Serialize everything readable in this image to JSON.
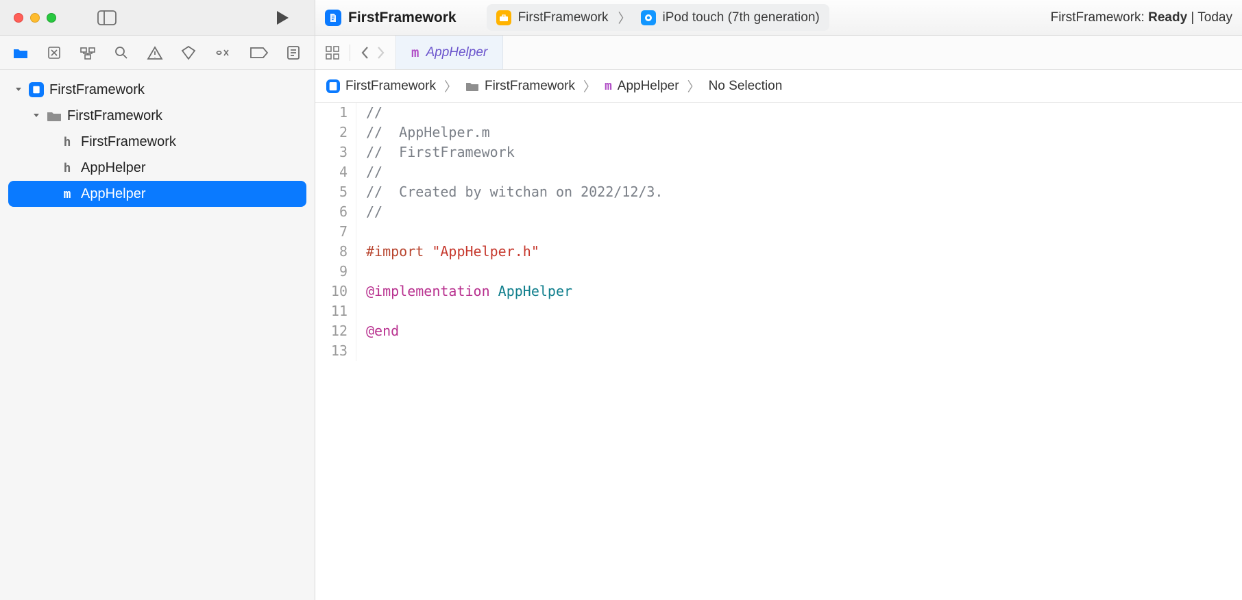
{
  "titlebar": {
    "project": "FirstFramework",
    "scheme": {
      "target": "FirstFramework",
      "device": "iPod touch (7th generation)"
    },
    "status": {
      "project": "FirstFramework",
      "state": "Ready",
      "time": "Today"
    }
  },
  "tree": {
    "root": "FirstFramework",
    "group": "FirstFramework",
    "files": [
      {
        "name": "FirstFramework",
        "icon": "h"
      },
      {
        "name": "AppHelper",
        "icon": "h"
      },
      {
        "name": "AppHelper",
        "icon": "m",
        "selected": true
      }
    ]
  },
  "tab": {
    "name": "AppHelper",
    "badge": "m"
  },
  "jumpbar": {
    "crumbs": [
      "FirstFramework",
      "FirstFramework",
      "AppHelper",
      "No Selection"
    ]
  },
  "code": {
    "lines": [
      {
        "n": 1,
        "tokens": [
          {
            "t": "//",
            "c": "comment"
          }
        ]
      },
      {
        "n": 2,
        "tokens": [
          {
            "t": "//  AppHelper.m",
            "c": "comment"
          }
        ]
      },
      {
        "n": 3,
        "tokens": [
          {
            "t": "//  FirstFramework",
            "c": "comment"
          }
        ]
      },
      {
        "n": 4,
        "tokens": [
          {
            "t": "//",
            "c": "comment"
          }
        ]
      },
      {
        "n": 5,
        "tokens": [
          {
            "t": "//  Created by witchan on 2022/12/3.",
            "c": "comment"
          }
        ]
      },
      {
        "n": 6,
        "tokens": [
          {
            "t": "//",
            "c": "comment"
          }
        ]
      },
      {
        "n": 7,
        "tokens": [
          {
            "t": "",
            "c": "plain"
          }
        ]
      },
      {
        "n": 8,
        "tokens": [
          {
            "t": "#import ",
            "c": "keyword"
          },
          {
            "t": "\"AppHelper.h\"",
            "c": "string"
          }
        ]
      },
      {
        "n": 9,
        "tokens": [
          {
            "t": "",
            "c": "plain"
          }
        ]
      },
      {
        "n": 10,
        "tokens": [
          {
            "t": "@implementation",
            "c": "at"
          },
          {
            "t": " ",
            "c": "plain"
          },
          {
            "t": "AppHelper",
            "c": "type"
          }
        ]
      },
      {
        "n": 11,
        "tokens": [
          {
            "t": "",
            "c": "plain"
          }
        ]
      },
      {
        "n": 12,
        "tokens": [
          {
            "t": "@end",
            "c": "at"
          }
        ]
      },
      {
        "n": 13,
        "tokens": [
          {
            "t": "",
            "c": "plain"
          }
        ]
      }
    ],
    "highlighted_line": 1
  }
}
